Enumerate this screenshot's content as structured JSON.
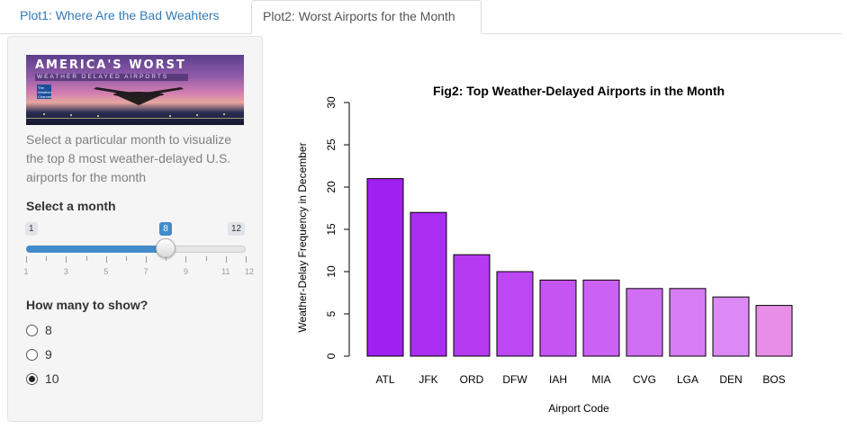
{
  "tabs": [
    {
      "label": "Plot1: Where Are the Bad Weahters",
      "active": false
    },
    {
      "label": "Plot2: Worst Airports for the Month",
      "active": true
    }
  ],
  "sidebar": {
    "banner": {
      "title": "AMERICA'S WORST",
      "subtitle": "WEATHER DELAYED AIRPORTS",
      "logo_text": "The Weather Channel"
    },
    "description": "Select a particular month to visualize the top 8 most weather-delayed U.S. airports for the month",
    "month_label": "Select a month",
    "slider": {
      "min": 1,
      "max": 12,
      "value": 8,
      "min_text": "1",
      "max_text": "12",
      "value_text": "8",
      "grid_labels": [
        "1",
        "3",
        "5",
        "7",
        "9",
        "11",
        "12"
      ]
    },
    "count_label": "How many to show?",
    "radio_options": [
      {
        "label": "8",
        "checked": false
      },
      {
        "label": "9",
        "checked": false
      },
      {
        "label": "10",
        "checked": true
      }
    ]
  },
  "colors": {
    "accent": "#428bca",
    "link": "#337ab7"
  },
  "chart_data": {
    "type": "bar",
    "title": "Fig2: Top Weather-Delayed Airports in the Month",
    "xlabel": "Airport Code",
    "ylabel": "Weather-Delay Frequency in December",
    "categories": [
      "ATL",
      "JFK",
      "ORD",
      "DFW",
      "IAH",
      "MIA",
      "CVG",
      "LGA",
      "DEN",
      "BOS"
    ],
    "values": [
      21,
      17,
      12,
      10,
      9,
      9,
      8,
      8,
      7,
      6
    ],
    "colors": [
      "#a020f0",
      "#ab2df1",
      "#b53af2",
      "#bd47f2",
      "#c455f3",
      "#cb62f3",
      "#d16ff4",
      "#d77cf4",
      "#dd89f5",
      "#e88ee9"
    ],
    "ylim": [
      0,
      30
    ],
    "yticks": [
      "0",
      "5",
      "10",
      "15",
      "20",
      "25",
      "30"
    ],
    "grid": false
  }
}
